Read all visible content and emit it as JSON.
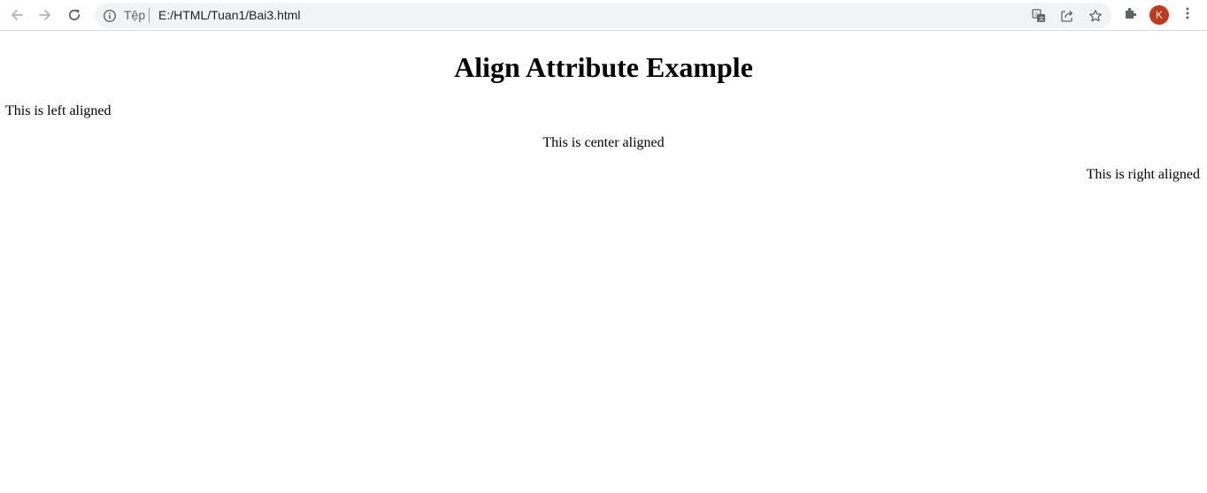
{
  "browser": {
    "omnibox": {
      "scheme_label": "Tệp",
      "url": "E:/HTML/Tuan1/Bai3.html"
    },
    "profile_initial": "K",
    "colors": {
      "toolbar_bg": "#ffffff",
      "omnibox_bg": "#f1f3f4",
      "icon_color": "#5f6368",
      "avatar_bg": "#c5381a"
    },
    "icons": {
      "back": "arrow-left-icon",
      "forward": "arrow-right-icon",
      "reload": "reload-icon",
      "site_info": "info-icon",
      "translate": "translate-icon",
      "share": "share-icon",
      "bookmark": "star-icon",
      "extensions": "puzzle-icon",
      "menu": "kebab-menu-icon"
    }
  },
  "page": {
    "heading": "Align Attribute Example",
    "paragraphs": {
      "left": "This is left aligned",
      "center": "This is center aligned",
      "right": "This is right aligned"
    }
  }
}
